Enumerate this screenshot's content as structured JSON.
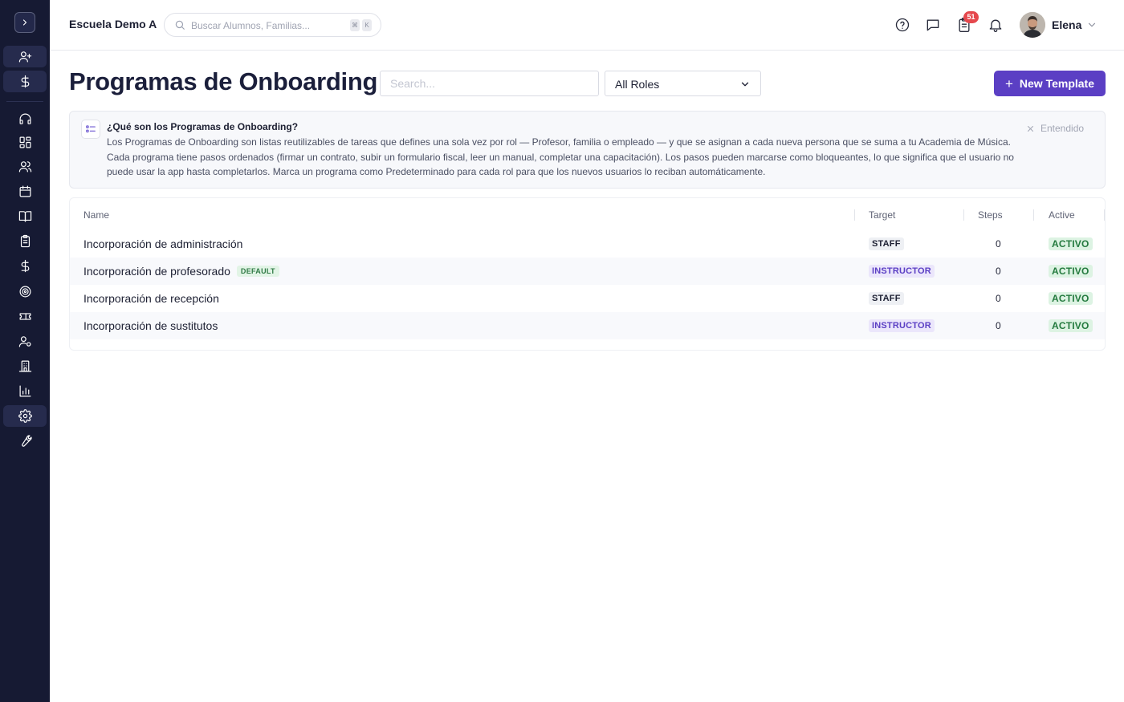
{
  "sidebar": {
    "toggle_icon": "chevron-right-icon",
    "items": [
      {
        "icon": "user-plus-icon",
        "highlighted": true
      },
      {
        "icon": "dollar-icon",
        "highlighted": true
      },
      {
        "icon": "headset-icon",
        "highlighted": false
      },
      {
        "icon": "grid-icon",
        "highlighted": false
      },
      {
        "icon": "users-icon",
        "highlighted": false
      },
      {
        "icon": "calendar-icon",
        "highlighted": false
      },
      {
        "icon": "book-icon",
        "highlighted": false
      },
      {
        "icon": "clipboard-icon",
        "highlighted": false
      },
      {
        "icon": "dollar-icon",
        "highlighted": false
      },
      {
        "icon": "target-icon",
        "highlighted": false
      },
      {
        "icon": "ticket-icon",
        "highlighted": false
      },
      {
        "icon": "user-settings-icon",
        "highlighted": false
      },
      {
        "icon": "building-icon",
        "highlighted": false
      },
      {
        "icon": "bar-chart-icon",
        "highlighted": false
      },
      {
        "icon": "gear-icon",
        "highlighted": true
      },
      {
        "icon": "wrench-icon",
        "highlighted": false
      }
    ]
  },
  "topbar": {
    "school_name": "Escuela Demo A",
    "search_placeholder": "Buscar Alumnos, Familias...",
    "shortcut_keys": [
      "⌘",
      "K"
    ],
    "notification_count": "51",
    "user_name": "Elena"
  },
  "page": {
    "title": "Programas de Onboarding",
    "search_placeholder": "Search...",
    "role_filter": "All Roles",
    "new_button": "New Template"
  },
  "info": {
    "title": "¿Qué son los Programas de Onboarding?",
    "body": "Los Programas de Onboarding son listas reutilizables de tareas que defines una sola vez por rol — Profesor, familia o empleado — y que se asignan a cada nueva persona que se suma a tu Academia de Música. Cada programa tiene pasos ordenados (firmar un contrato, subir un formulario fiscal, leer un manual, completar una capacitación). Los pasos pueden marcarse como bloqueantes, lo que significa que el usuario no puede usar la app hasta completarlos. Marca un programa como Predeterminado para cada rol para que los nuevos usuarios lo reciban automáticamente.",
    "dismiss": "Entendido"
  },
  "table": {
    "columns": [
      "Name",
      "Target",
      "Steps",
      "Active"
    ],
    "rows": [
      {
        "name": "Incorporación de administración",
        "default": "",
        "target": "STAFF",
        "steps": "0",
        "active": "ACTIVO"
      },
      {
        "name": "Incorporación de profesorado",
        "default": "DEFAULT",
        "target": "INSTRUCTOR",
        "steps": "0",
        "active": "ACTIVO"
      },
      {
        "name": "Incorporación de recepción",
        "default": "",
        "target": "STAFF",
        "steps": "0",
        "active": "ACTIVO"
      },
      {
        "name": "Incorporación de sustitutos",
        "default": "",
        "target": "INSTRUCTOR",
        "steps": "0",
        "active": "ACTIVO"
      }
    ]
  },
  "colors": {
    "sidebar_bg": "#161a33",
    "accent": "#5b3fc4",
    "badge": "#e5484d",
    "active_green": "#237a3e"
  }
}
